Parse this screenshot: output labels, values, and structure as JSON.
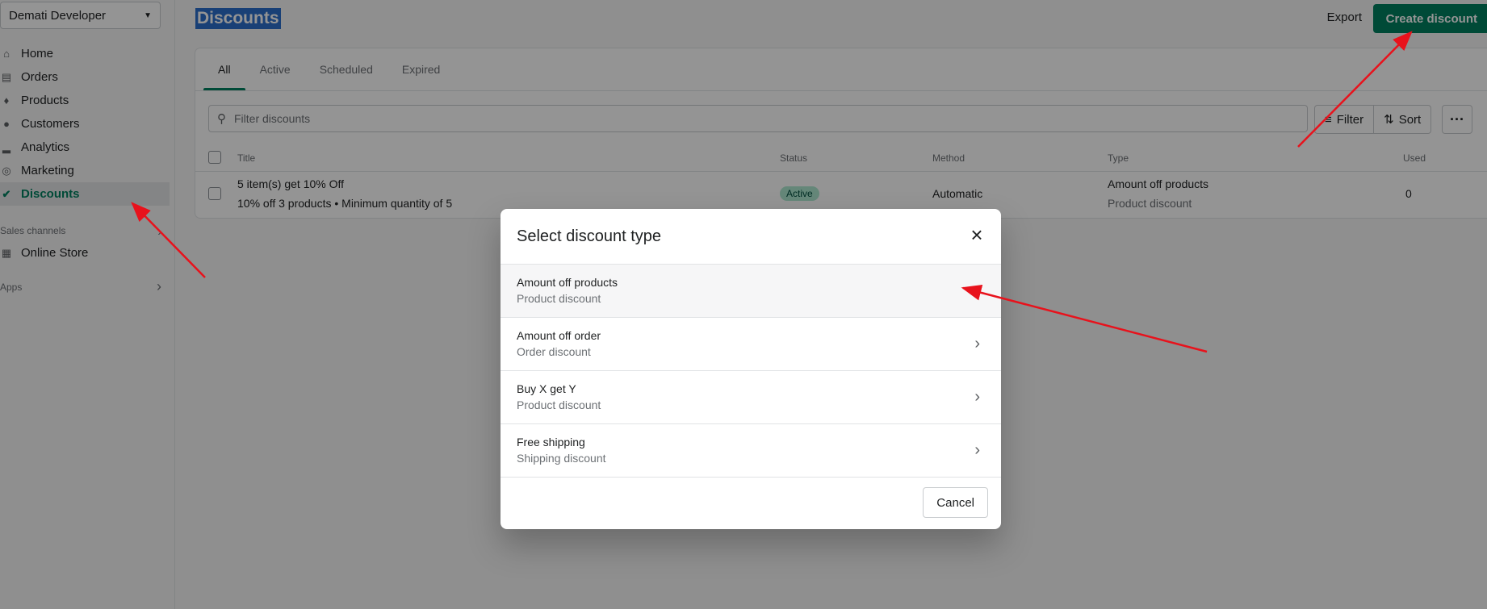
{
  "sidebar": {
    "store_name": "Demati Developer",
    "items": [
      {
        "label": "Home",
        "icon": "home-icon"
      },
      {
        "label": "Orders",
        "icon": "orders-icon"
      },
      {
        "label": "Products",
        "icon": "tag-icon"
      },
      {
        "label": "Customers",
        "icon": "person-icon"
      },
      {
        "label": "Analytics",
        "icon": "bar-chart-icon"
      },
      {
        "label": "Marketing",
        "icon": "target-icon"
      },
      {
        "label": "Discounts",
        "icon": "discount-icon"
      }
    ],
    "sales_channels_label": "Sales channels",
    "online_store_label": "Online Store",
    "apps_label": "Apps"
  },
  "header": {
    "title": "Discounts",
    "export_label": "Export",
    "create_label": "Create discount"
  },
  "tabs": [
    "All",
    "Active",
    "Scheduled",
    "Expired"
  ],
  "filter": {
    "placeholder": "Filter discounts",
    "filter_label": "Filter",
    "sort_label": "Sort",
    "more_label": "···"
  },
  "table": {
    "columns": [
      "Title",
      "Status",
      "Method",
      "Type",
      "Used"
    ],
    "rows": [
      {
        "title": "5 item(s) get 10% Off",
        "subtitle": "10% off 3 products • Minimum quantity of 5",
        "status": "Active",
        "method": "Automatic",
        "type": "Amount off products",
        "type_sub": "Product discount",
        "used": "0"
      }
    ]
  },
  "modal": {
    "title": "Select discount type",
    "options": [
      {
        "title": "Amount off products",
        "subtitle": "Product discount"
      },
      {
        "title": "Amount off order",
        "subtitle": "Order discount"
      },
      {
        "title": "Buy X get Y",
        "subtitle": "Product discount"
      },
      {
        "title": "Free shipping",
        "subtitle": "Shipping discount"
      }
    ],
    "cancel_label": "Cancel"
  },
  "colors": {
    "accent": "#008060",
    "annotation_arrow": "#e8121c"
  }
}
